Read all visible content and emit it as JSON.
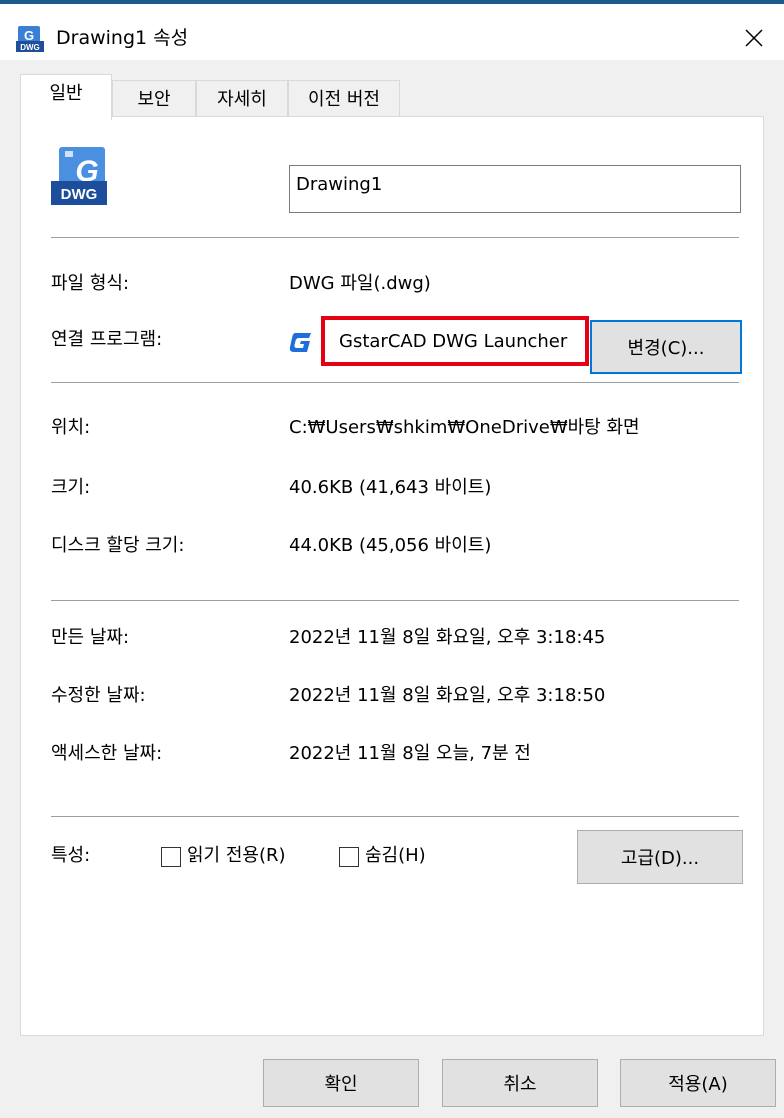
{
  "window": {
    "title": "Drawing1 속성",
    "close_glyph": "✕"
  },
  "tabs": [
    {
      "label": "일반",
      "active": true
    },
    {
      "label": "보안",
      "active": false
    },
    {
      "label": "자세히",
      "active": false
    },
    {
      "label": "이전 버전",
      "active": false
    }
  ],
  "general": {
    "file_name": "Drawing1",
    "icon": "dwg-file-icon",
    "file_type_label": "파일 형식:",
    "file_type_value": "DWG 파일(.dwg)",
    "opens_with_label": "연결 프로그램:",
    "opens_with_value": "GstarCAD DWG Launcher",
    "change_button": "변경(C)...",
    "location_label": "위치:",
    "location_value": "C:₩Users₩shkim₩OneDrive₩바탕 화면",
    "size_label": "크기:",
    "size_value": "40.6KB (41,643 바이트)",
    "size_on_disk_label": "디스크 할당 크기:",
    "size_on_disk_value": "44.0KB (45,056 바이트)",
    "created_label": "만든 날짜:",
    "created_value": "2022년 11월 8일 화요일, 오후 3:18:45",
    "modified_label": "수정한 날짜:",
    "modified_value": "2022년 11월 8일 화요일, 오후 3:18:50",
    "accessed_label": "액세스한 날짜:",
    "accessed_value": "2022년 11월 8일 오늘, 7분 전",
    "attributes_label": "특성:",
    "readonly_label": "읽기 전용(R)",
    "hidden_label": "숨김(H)",
    "advanced_button": "고급(D)..."
  },
  "footer": {
    "ok": "확인",
    "cancel": "취소",
    "apply": "적용(A)"
  },
  "colors": {
    "highlight": "#e50012",
    "accent": "#0078d7",
    "gstar_blue": "#1e6fd9"
  }
}
